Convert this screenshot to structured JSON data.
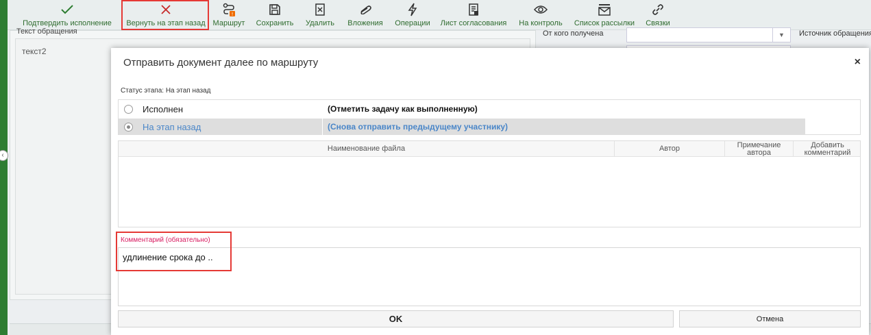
{
  "toolbar": {
    "confirm": "Подтвердить исполнение",
    "return_back": "Вернуть на этап назад",
    "route": "Маршрут",
    "save": "Сохранить",
    "delete": "Удалить",
    "attachments": "Вложения",
    "operations": "Операции",
    "approval_sheet": "Лист согласования",
    "control": "На контроль",
    "mailing_list": "Список рассылки",
    "links": "Связки"
  },
  "background": {
    "request_text_label": "Текст обращения",
    "request_text_value": "текст2",
    "received_from_label": "От кого получена",
    "request_source_label": "Источник обращения"
  },
  "modal": {
    "title": "Отправить документ далее по маршруту",
    "close_symbol": "×",
    "status_label": "Статус этапа: На этап назад",
    "options": [
      {
        "name": "Исполнен",
        "description": "(Отметить задачу как выполненную)",
        "selected": false
      },
      {
        "name": "На этап назад",
        "description": "(Снова отправить предыдущему участнику)",
        "selected": true
      }
    ],
    "files_table": {
      "col_name": "Наименование файла",
      "col_author": "Автор",
      "col_note_line1": "Примечание",
      "col_note_line2": "автора",
      "col_add_line1": "Добавить",
      "col_add_line2": "комментарий"
    },
    "comment_label": "Комментарий (обязательно)",
    "comment_value": "удлинение срока до ..",
    "ok_label": "OK",
    "cancel_label": "Отмена"
  },
  "colors": {
    "toolbar_icon_green": "#2e7d32",
    "return_icon_red": "#c62828",
    "highlight_red": "#e53935",
    "selected_option_blue": "#4a86c8",
    "required_label_pink": "#d81b60"
  }
}
